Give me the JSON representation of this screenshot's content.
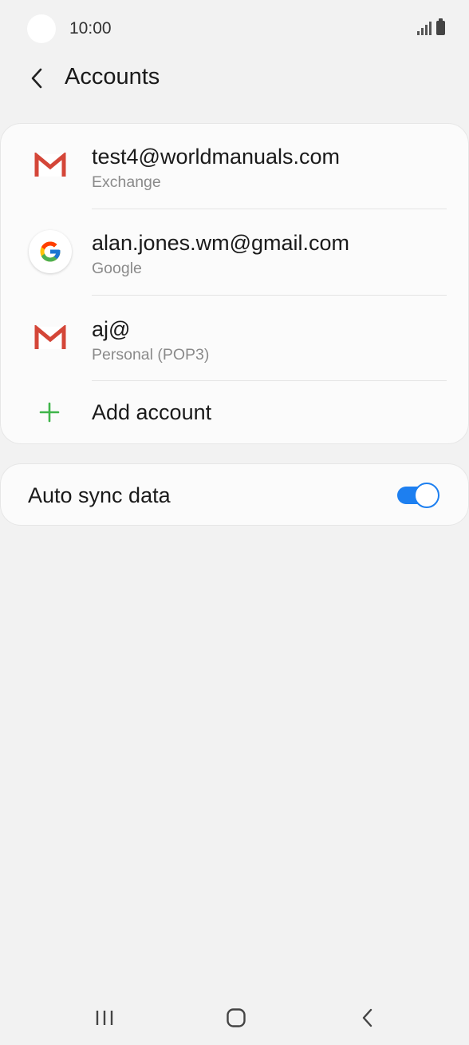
{
  "status_bar": {
    "time": "10:00",
    "icons": [
      "signal-icon",
      "battery-icon"
    ]
  },
  "header": {
    "title": "Accounts",
    "back_icon": "chevron-left-icon"
  },
  "accounts": [
    {
      "primary": "test4@worldmanuals.com",
      "secondary": "Exchange",
      "icon": "gmail-icon"
    },
    {
      "primary": "alan.jones.wm@gmail.com",
      "secondary": "Google",
      "icon": "google-icon"
    },
    {
      "primary": "aj@",
      "secondary": "Personal (POP3)",
      "icon": "gmail-icon"
    }
  ],
  "add_account": {
    "label": "Add account",
    "icon": "plus-icon"
  },
  "auto_sync": {
    "label": "Auto sync data",
    "enabled": true
  },
  "nav_bar": {
    "icons": [
      "recent-apps-icon",
      "home-icon",
      "back-icon"
    ]
  },
  "colors": {
    "background": "#f2f2f2",
    "card": "#fbfbfb",
    "accent": "#1d7ff0",
    "plus": "#3fb54a",
    "gmail_red": "#d44638",
    "secondary_text": "#8a8a8a"
  }
}
